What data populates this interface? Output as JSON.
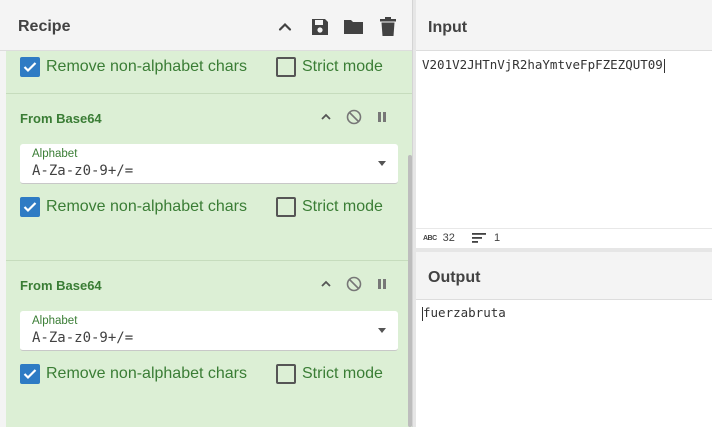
{
  "recipe": {
    "title": "Recipe",
    "icons": [
      "chevron-up-icon",
      "save-icon",
      "folder-icon",
      "trash-icon"
    ],
    "partial_op": {
      "remove_label": "Remove non-alphabet chars",
      "remove_checked": true,
      "strict_label": "Strict mode",
      "strict_checked": false
    },
    "operations": [
      {
        "title": "From Base64",
        "alphabet_label": "Alphabet",
        "alphabet_value": "A-Za-z0-9+/=",
        "remove_label": "Remove non-alphabet chars",
        "remove_checked": true,
        "strict_label": "Strict mode",
        "strict_checked": false
      },
      {
        "title": "From Base64",
        "alphabet_label": "Alphabet",
        "alphabet_value": "A-Za-z0-9+/=",
        "remove_label": "Remove non-alphabet chars",
        "remove_checked": true,
        "strict_label": "Strict mode",
        "strict_checked": false
      }
    ]
  },
  "input": {
    "title": "Input",
    "value": "V201V2JHTnVjR2haYmtveFpFZEZQUT09",
    "stats": {
      "length": "32",
      "lines": "1"
    }
  },
  "output": {
    "title": "Output",
    "value": "fuerzabruta"
  },
  "colors": {
    "op_background": "#dcefd5",
    "op_text": "#3a7d35",
    "checkbox_checked": "#2e7bc4"
  }
}
